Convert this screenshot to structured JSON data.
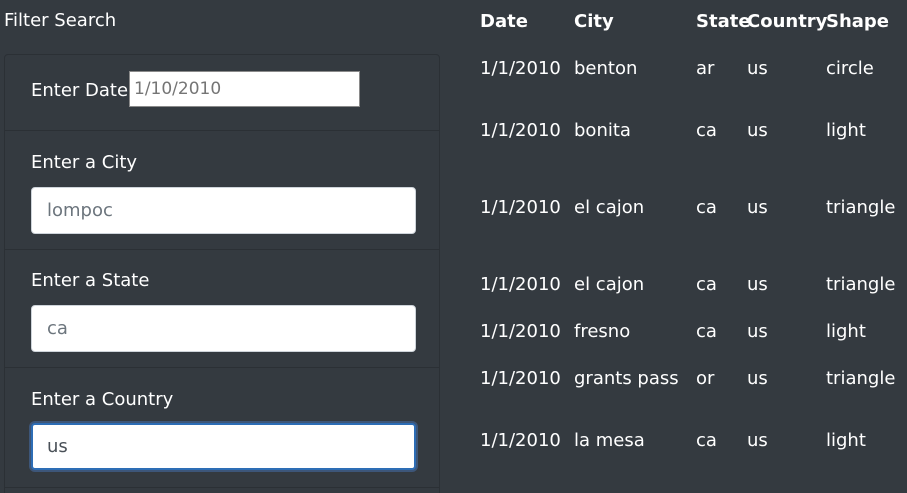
{
  "filter": {
    "title": "Filter Search",
    "date": {
      "label": "Enter Date",
      "value": "",
      "placeholder": "1/10/2010"
    },
    "city": {
      "label": "Enter a City",
      "value": "",
      "placeholder": "lompoc"
    },
    "state": {
      "label": "Enter a State",
      "value": "",
      "placeholder": "ca"
    },
    "country": {
      "label": "Enter a Country",
      "value": "us",
      "placeholder": ""
    }
  },
  "table": {
    "headers": [
      "Date",
      "City",
      "State",
      "Country",
      "Shape"
    ],
    "rows": [
      {
        "date": "1/1/2010",
        "city": "benton",
        "state": "ar",
        "country": "us",
        "shape": "circle"
      },
      {
        "date": "1/1/2010",
        "city": "bonita",
        "state": "ca",
        "country": "us",
        "shape": "light"
      },
      {
        "date": "1/1/2010",
        "city": "el cajon",
        "state": "ca",
        "country": "us",
        "shape": "triangle"
      },
      {
        "date": "1/1/2010",
        "city": "el cajon",
        "state": "ca",
        "country": "us",
        "shape": "triangle"
      },
      {
        "date": "1/1/2010",
        "city": "fresno",
        "state": "ca",
        "country": "us",
        "shape": "light"
      },
      {
        "date": "1/1/2010",
        "city": "grants pass",
        "state": "or",
        "country": "us",
        "shape": "triangle"
      },
      {
        "date": "1/1/2010",
        "city": "la mesa",
        "state": "ca",
        "country": "us",
        "shape": "light"
      }
    ]
  }
}
